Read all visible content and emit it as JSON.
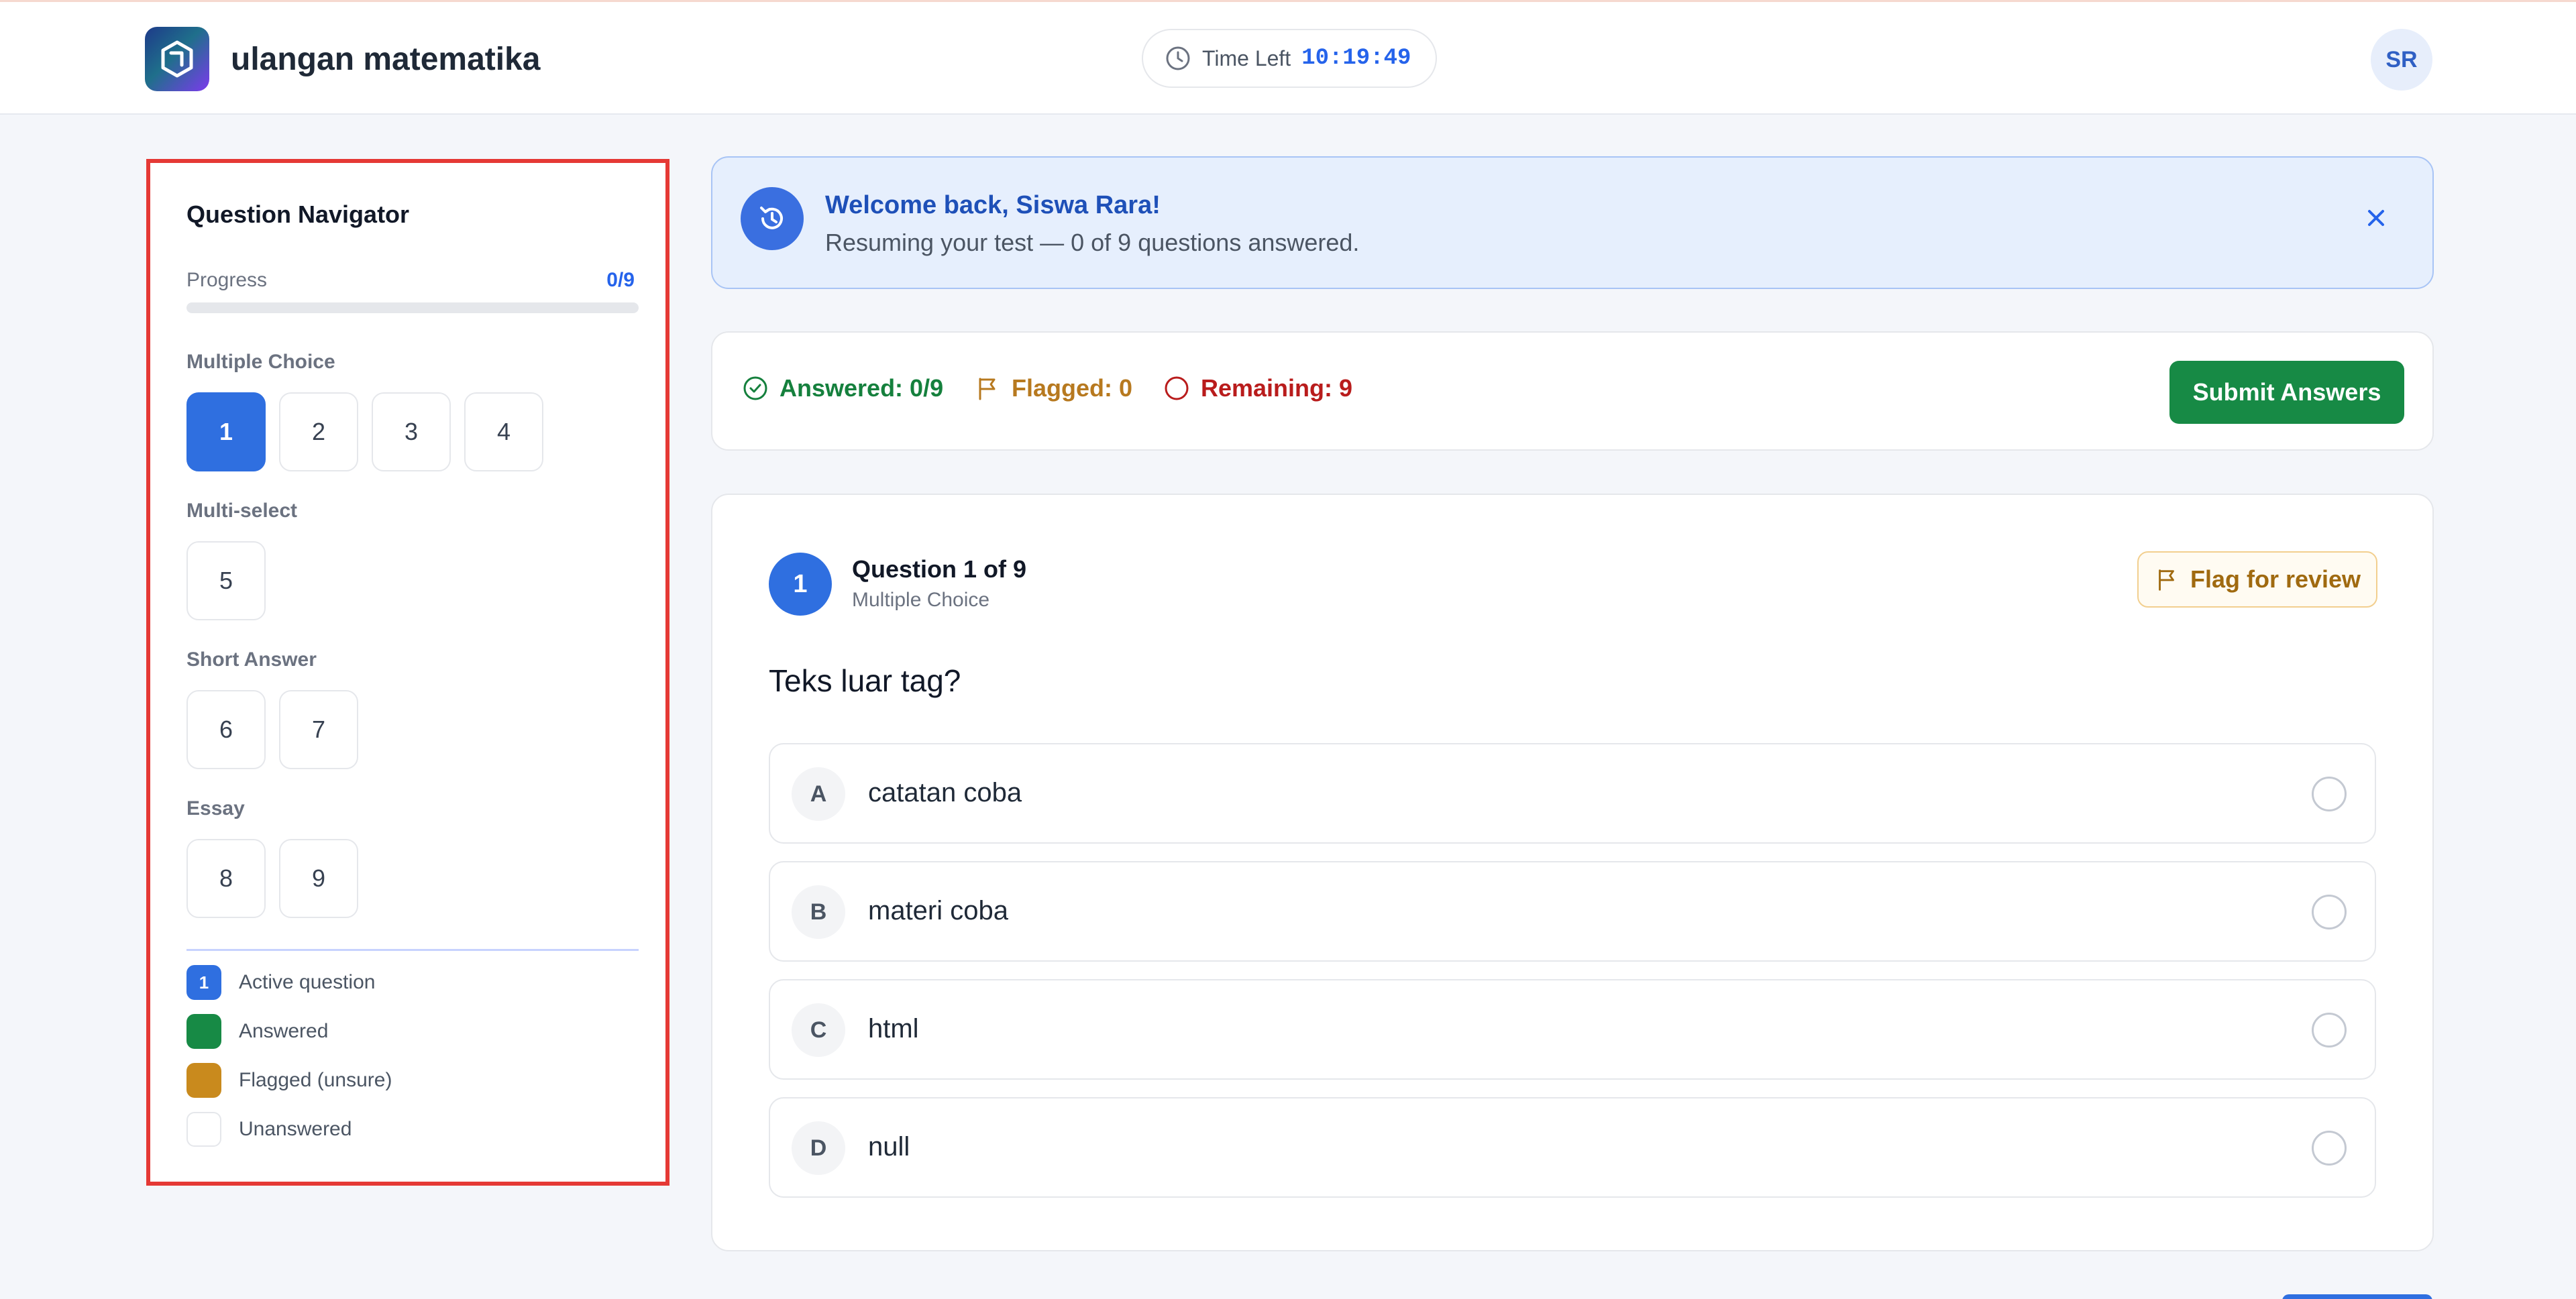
{
  "header": {
    "app_title": "ulangan matematika",
    "timer_label": "Time Left",
    "timer_value": "10:19:49",
    "avatar_initials": "SR"
  },
  "navigator": {
    "title": "Question Navigator",
    "progress_label": "Progress",
    "progress_count": "0/9",
    "progress_fraction": 0,
    "sections": [
      {
        "label": "Multiple Choice",
        "questions": [
          "1",
          "2",
          "3",
          "4"
        ]
      },
      {
        "label": "Multi-select",
        "questions": [
          "5"
        ]
      },
      {
        "label": "Short Answer",
        "questions": [
          "6",
          "7"
        ]
      },
      {
        "label": "Essay",
        "questions": [
          "8",
          "9"
        ]
      }
    ],
    "active_question": "1",
    "legend": [
      {
        "label": "Active question",
        "swatch_text": "1",
        "color": "#2f6fe0"
      },
      {
        "label": "Answered",
        "color": "#178a45"
      },
      {
        "label": "Flagged (unsure)",
        "color": "#c98a1d"
      },
      {
        "label": "Unanswered",
        "color": "#ffffff"
      }
    ]
  },
  "welcome": {
    "title": "Welcome back, Siswa Rara!",
    "subtitle": "Resuming your test — 0 of 9 questions answered."
  },
  "status": {
    "answered": "Answered: 0/9",
    "flagged": "Flagged: 0",
    "remaining": "Remaining: 9",
    "submit_label": "Submit Answers"
  },
  "question": {
    "number": "1",
    "heading": "Question 1 of 9",
    "type": "Multiple Choice",
    "flag_label": "Flag for review",
    "text": "Teks luar tag?",
    "options": [
      {
        "letter": "A",
        "text": "catatan coba"
      },
      {
        "letter": "B",
        "text": "materi coba"
      },
      {
        "letter": "C",
        "text": "html"
      },
      {
        "letter": "D",
        "text": "null"
      }
    ]
  },
  "colors": {
    "primary": "#2f6fe0",
    "success": "#178a45",
    "warning": "#c98a1d",
    "danger": "#b91c1c"
  }
}
